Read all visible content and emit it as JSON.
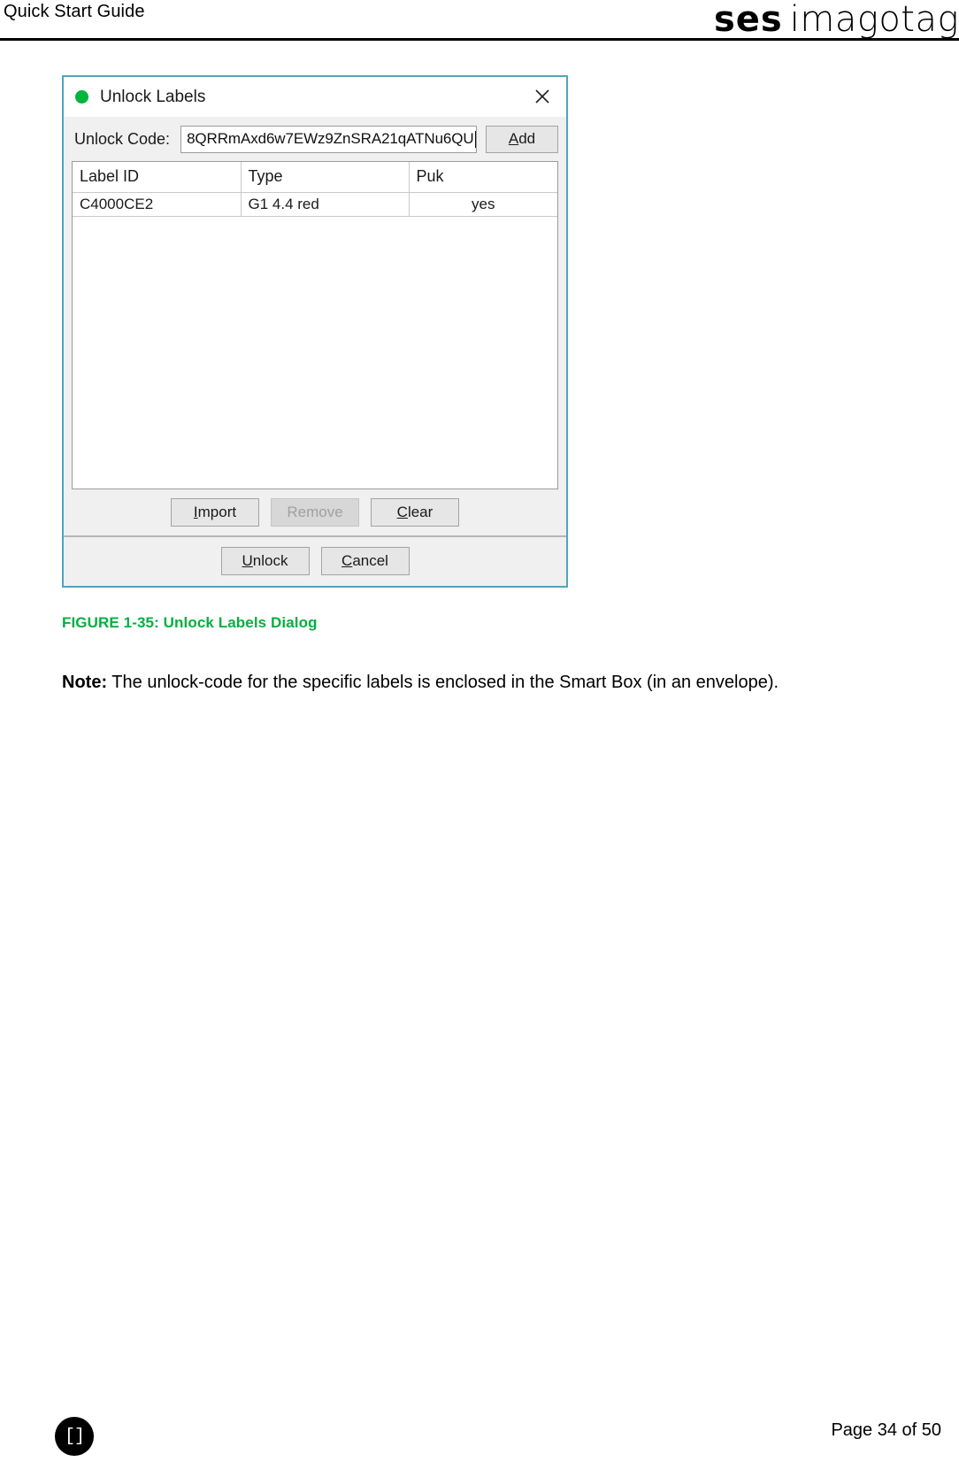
{
  "header": {
    "title": "Quick Start Guide",
    "brand_primary": "ses",
    "brand_secondary": "imagotag"
  },
  "dialog": {
    "title": "Unlock Labels",
    "status_dot_color": "#00B53C",
    "border_color": "#4EA6BC",
    "close_icon": "close-icon",
    "code_label": "Unlock Code:",
    "code_value": "8QRRmAxd6w7EWz9ZnSRA21qATNu6QU",
    "code_placeholder": "",
    "add_label": "Add",
    "table": {
      "columns": [
        "Label ID",
        "Type",
        "Puk"
      ],
      "rows": [
        [
          "C4000CE2",
          "G1 4.4 red",
          "yes"
        ]
      ]
    },
    "buttons_mid": [
      {
        "label": "Import",
        "disabled": false
      },
      {
        "label": "Remove",
        "disabled": true
      },
      {
        "label": "Clear",
        "disabled": false
      }
    ],
    "buttons_bottom": [
      {
        "label": "Unlock",
        "disabled": false
      },
      {
        "label": "Cancel",
        "disabled": false
      }
    ]
  },
  "figure": {
    "caption": "FIGURE 1-35: Unlock Labels Dialog",
    "caption_color": "#00B140"
  },
  "note": {
    "label": "Note:",
    "text": " The unlock-code for the specific labels is enclosed in the Smart Box (in an envelope)."
  },
  "footer": {
    "logo_glyph": "[]",
    "page_text": "Page 34 of 50"
  }
}
